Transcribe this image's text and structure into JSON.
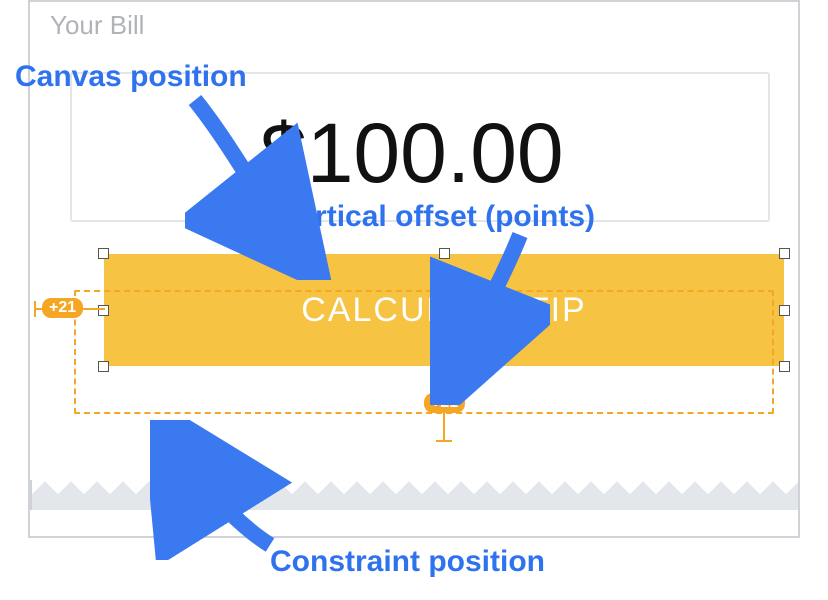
{
  "label": "Your Bill",
  "amount": "$100.00",
  "button": {
    "label": "CALCULATE TIP"
  },
  "offsets": {
    "horizontal": "+21",
    "vertical": "+21"
  },
  "annotations": {
    "canvas": "Canvas position",
    "vertical": "Vertical offset (points)",
    "constraint": "Constraint position"
  }
}
